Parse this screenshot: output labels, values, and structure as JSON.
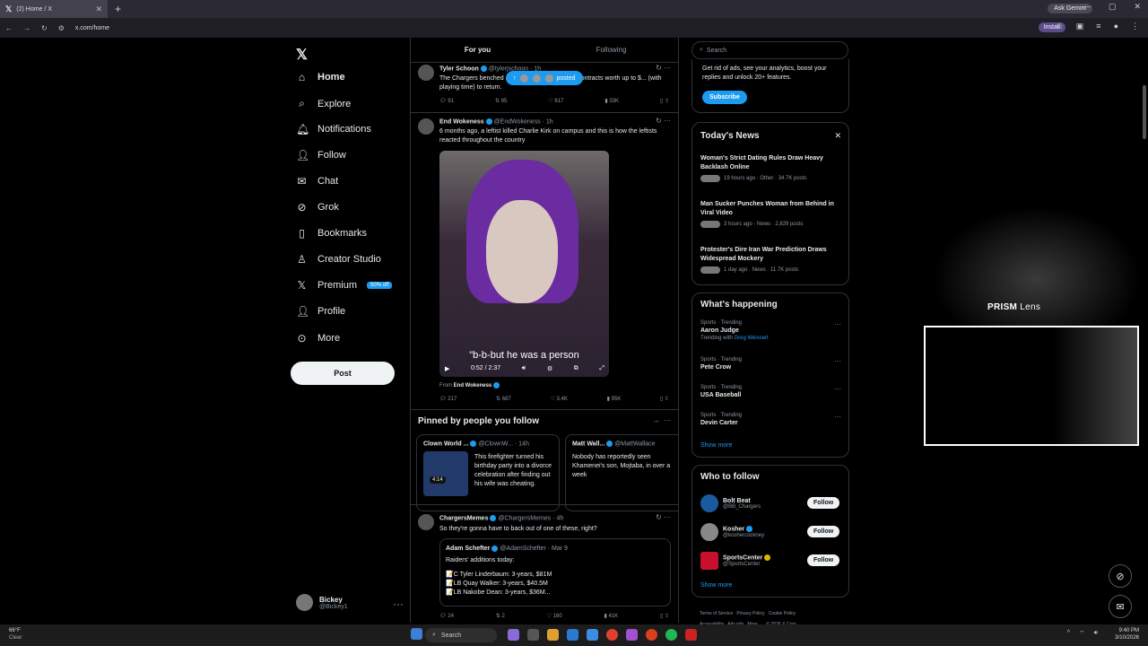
{
  "browser": {
    "tab_title": "(2) Home / X",
    "url": "x.com/home",
    "ask_gemini": "Ask Gemini",
    "install": "Install"
  },
  "nav": {
    "items": [
      {
        "label": "Home",
        "icon": "home-icon"
      },
      {
        "label": "Explore",
        "icon": "search-icon"
      },
      {
        "label": "Notifications",
        "icon": "bell-icon"
      },
      {
        "label": "Follow",
        "icon": "person-add-icon"
      },
      {
        "label": "Chat",
        "icon": "mail-icon"
      },
      {
        "label": "Grok",
        "icon": "grok-icon"
      },
      {
        "label": "Bookmarks",
        "icon": "bookmark-icon"
      },
      {
        "label": "Creator Studio",
        "icon": "creator-icon"
      },
      {
        "label": "Premium",
        "icon": "x-icon"
      },
      {
        "label": "Profile",
        "icon": "user-icon"
      },
      {
        "label": "More",
        "icon": "more-circle-icon"
      }
    ],
    "premium_badge": "50% off",
    "post": "Post",
    "account": {
      "name": "Bickey",
      "handle": "@Bickey1"
    }
  },
  "feed": {
    "tabs": [
      "For you",
      "Following"
    ],
    "toast": "posted",
    "posts": [
      {
        "name": "Tyler Schoon",
        "handle": "@tylerjschoon · 1h",
        "text": "The Chargers benched ... Pipkins and gave them contracts worth up to $... (with playing time) to return.",
        "actions": [
          "91",
          "95",
          "617",
          "33K"
        ]
      },
      {
        "name": "End Wokeness",
        "handle": "@EndWokeness · 1h",
        "text": "6 months ago, a leftist killed Charlie Kirk on campus and this is how the leftists reacted throughout the country",
        "video_caption": "\"b-b-but he was a person",
        "video_time": "0:52 / 2:37",
        "from": "From",
        "from_name": "End Wokeness",
        "actions": [
          "217",
          "687",
          "3.4K",
          "95K"
        ]
      },
      {
        "name": "ChargersMemes",
        "handle": "@ChargersMemes · 4h",
        "text": "So they're gonna have to back out of one of these, right?",
        "quote_name": "Adam Schefter",
        "quote_handle": "@AdamSchefter · Mar 9",
        "quote_lines": [
          "Raiders' additions today:",
          "",
          "📝C Tyler Linderbaum: 3-years, $81M",
          "📝LB Quay Walker: 3-years, $40.5M",
          "📝LB Nakobe Dean: 3-years, $36M..."
        ],
        "actions": [
          "24",
          "2",
          "160",
          "41K"
        ]
      }
    ],
    "pinned": {
      "title": "Pinned by people you follow",
      "cards": [
        {
          "name": "Clown World ...",
          "handle": "@ClownW... · 14h",
          "text": "This firefighter turned his birthday party into a divorce celebration after finding out his wife was cheating.",
          "duration": "4:14"
        },
        {
          "name": "Matt Wall...",
          "handle": "@MattWallace",
          "text": "Nobody has reportedly seen Khamenei's son, Mojtaba, in over a week"
        }
      ]
    }
  },
  "sidebar": {
    "search_placeholder": "Search",
    "premium_text": "Get rid of ads, see your analytics, boost your replies and unlock 20+ features.",
    "subscribe": "Subscribe",
    "news": {
      "title": "Today's News",
      "items": [
        {
          "title": "Woman's Strict Dating Rules Draw Heavy Backlash Online",
          "meta": "19 hours ago · Other · 34.7K posts"
        },
        {
          "title": "Man Sucker Punches Woman from Behind in Viral Video",
          "meta": "3 hours ago · News · 2,829 posts"
        },
        {
          "title": "Protester's Dire Iran War Prediction Draws Widespread Mockery",
          "meta": "1 day ago · News · 11.7K posts"
        }
      ]
    },
    "happening": {
      "title": "What's happening",
      "trends": [
        {
          "context": "Sports · Trending",
          "name": "Aaron Judge",
          "sub": "Trending with",
          "sub_link": "Greg Weissert"
        },
        {
          "context": "Sports · Trending",
          "name": "Pete Crow"
        },
        {
          "context": "Sports · Trending",
          "name": "USA Baseball"
        },
        {
          "context": "Sports · Trending",
          "name": "Devin Carter"
        }
      ],
      "show_more": "Show more"
    },
    "who_to_follow": {
      "title": "Who to follow",
      "accounts": [
        {
          "name": "Bolt Beat",
          "handle": "@BB_Chargers",
          "button": "Follow"
        },
        {
          "name": "Kosher",
          "handle": "@koshercockney",
          "button": "Follow"
        },
        {
          "name": "SportsCenter",
          "handle": "@SportsCenter",
          "button": "Follow"
        }
      ],
      "show_more": "Show more"
    },
    "footer": [
      "Terms of Service",
      "Privacy Policy",
      "Cookie Policy",
      "Accessibility",
      "Ads info",
      "More ...",
      "© 2026 X Corp."
    ]
  },
  "overlay": {
    "prism_brand": "PRISM",
    "prism_lens": " Lens"
  },
  "taskbar": {
    "temp": "66°F",
    "weather": "Clear",
    "search": "Search",
    "time": "9:40 PM",
    "date": "3/10/2026"
  },
  "colors": {
    "accent": "#1d9bf0",
    "background": "#000000",
    "border": "#2f3336"
  }
}
